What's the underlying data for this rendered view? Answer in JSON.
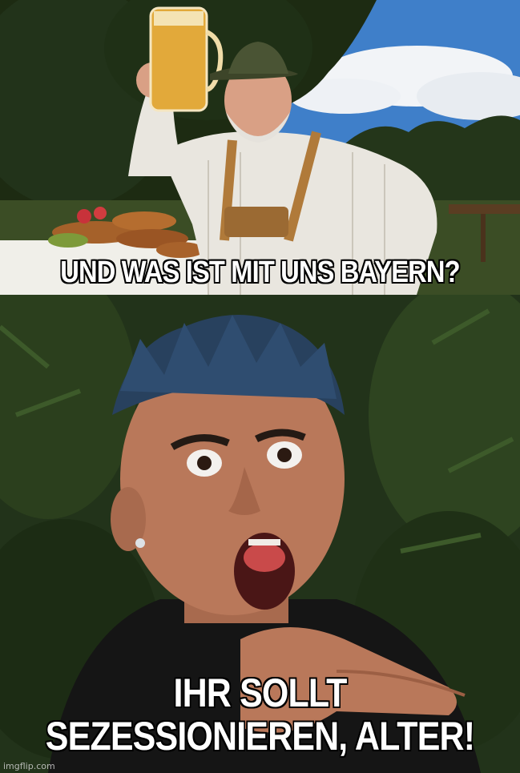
{
  "meme": {
    "top_caption": "UND WAS IST MIT UNS BAYERN?",
    "bottom_caption_line1": "IHR SOLLT",
    "bottom_caption_line2": "SEZESSIONIEREN, ALTER!",
    "watermark": "imgflip.com"
  },
  "colors": {
    "sky": "#3f7fc9",
    "cloud": "#f2f4f7",
    "foliage_dark": "#1d2b12",
    "shirt": "#e9e6df",
    "suspenders": "#b07a3a",
    "hat": "#4a5434",
    "beer": "#e2a93a",
    "jungle": "#2b3f1d",
    "skin": "#b9785a",
    "hair": "#28415e",
    "caption_text": "#ffffff",
    "caption_outline": "#000000"
  },
  "icons": [
    "beer-mug-icon",
    "pretzel-icon"
  ]
}
